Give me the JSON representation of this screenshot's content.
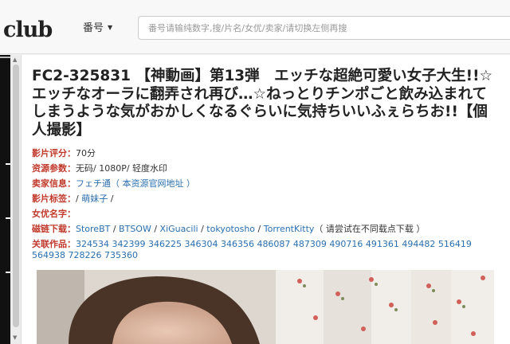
{
  "header": {
    "logo_text": "club",
    "search_type": "番号",
    "search_placeholder": "番号请输纯数字,搜/片名/女优/卖家/请切换左侧再搜"
  },
  "title": "FC2-325831 【神動画】第13弾　エッチな超絶可愛い女子大生!!☆エッチなオーラに翻弄され再び…☆ねっとりチンポごと飲み込まれてしまうような気がおかしくなるぐらいに気持ちいいふぇらちお!!【個人撮影】",
  "info": {
    "rating": {
      "label": "影片评分：",
      "value": "70分"
    },
    "params": {
      "label": "资源参数：",
      "value": "无码/ 1080P/ 轻度水印"
    },
    "seller": {
      "label": "卖家信息：",
      "seller_link": "フェチ通",
      "extra": "（ 本资源官网地址 ）"
    },
    "tags": {
      "label": "影片标签：",
      "prefix": "/ ",
      "tag": "萌妹子",
      "suffix": " /"
    },
    "actress": {
      "label": "女优名字：",
      "value": ""
    },
    "magnet": {
      "label": "磁链下载：",
      "links": [
        "StoreBT",
        "BTSOW",
        "XiGuacili",
        "tokyotosho",
        "TorrentKitty"
      ],
      "note": "（ 请尝试在不同载点下载 ）"
    },
    "related": {
      "label": "关联作品：",
      "ids": "324534 342399 346225 346304 346356 486087 487309 490716 491361 494482 516419 564938 728226 735360"
    }
  }
}
